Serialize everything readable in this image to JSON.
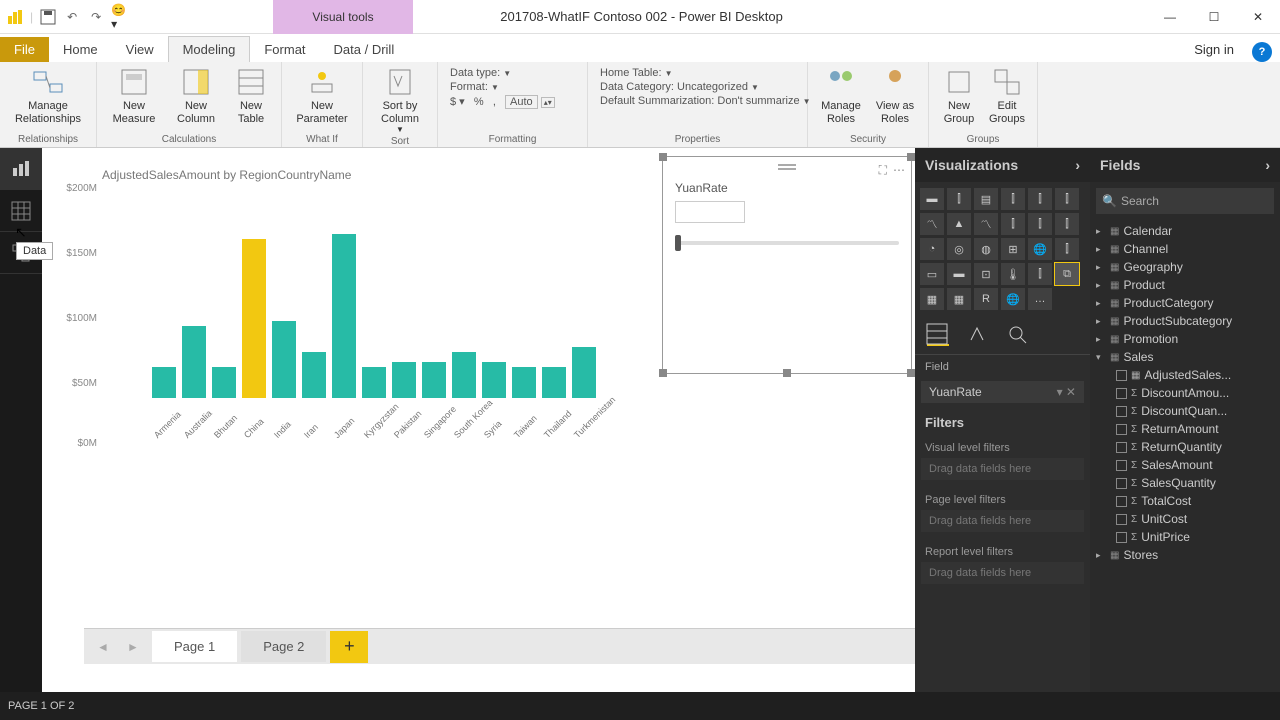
{
  "appTitle": "201708-WhatIF Contoso 002 - Power BI Desktop",
  "visualTools": "Visual tools",
  "quickAccess": {
    "undo": "↶",
    "redo": "↷"
  },
  "menus": {
    "file": "File",
    "home": "Home",
    "view": "View",
    "modeling": "Modeling",
    "format": "Format",
    "datadrill": "Data / Drill",
    "signin": "Sign in"
  },
  "ribbon": {
    "relationships": {
      "group": "Relationships",
      "manage": "Manage Relationships"
    },
    "calculations": {
      "group": "Calculations",
      "newMeasure": "New Measure",
      "newColumn": "New Column",
      "newTable": "New Table"
    },
    "whatif": {
      "group": "What If",
      "newParam": "New Parameter"
    },
    "sort": {
      "group": "Sort",
      "sortby": "Sort by Column"
    },
    "formatting": {
      "group": "Formatting",
      "datatype": "Data type:",
      "format": "Format:",
      "auto": "Auto"
    },
    "properties": {
      "group": "Properties",
      "hometable": "Home Table:",
      "datacat": "Data Category: Uncategorized",
      "summ": "Default Summarization: Don't summarize"
    },
    "security": {
      "group": "Security",
      "manageRoles": "Manage Roles",
      "viewAs": "View as Roles"
    },
    "groups": {
      "group": "Groups",
      "newGroup": "New Group",
      "editGroups": "Edit Groups"
    }
  },
  "leftbar": {
    "tooltip": "Data"
  },
  "chart": {
    "title": "AdjustedSalesAmount by RegionCountryName",
    "ylabels": [
      "$200M",
      "$150M",
      "$100M",
      "$50M",
      "$0M"
    ]
  },
  "chart_data": {
    "type": "bar",
    "title": "AdjustedSalesAmount by RegionCountryName",
    "ylabel": "AdjustedSalesAmount",
    "xlabel": "RegionCountryName",
    "ylim": [
      0,
      200
    ],
    "unit": "$M",
    "categories": [
      "Armenia",
      "Australia",
      "Bhutan",
      "China",
      "India",
      "Iran",
      "Japan",
      "Kyrgyzstan",
      "Pakistan",
      "Singapore",
      "South Korea",
      "Syria",
      "Taiwan",
      "Thailand",
      "Turkmenistan"
    ],
    "values": [
      30,
      70,
      30,
      155,
      75,
      45,
      160,
      30,
      35,
      35,
      45,
      35,
      30,
      30,
      50
    ],
    "highlight_index": 3
  },
  "slicer": {
    "title": "YuanRate"
  },
  "vizPane": {
    "title": "Visualizations",
    "fieldLabel": "Field",
    "fieldValue": "YuanRate"
  },
  "filtersPane": {
    "title": "Filters",
    "visualLevel": "Visual level filters",
    "drag": "Drag data fields here",
    "pageLevel": "Page level filters",
    "reportLevel": "Report level filters"
  },
  "fieldsPane": {
    "title": "Fields",
    "searchPlaceholder": "Search",
    "tables": [
      "Calendar",
      "Channel",
      "Geography",
      "Product",
      "ProductCategory",
      "ProductSubcategory",
      "Promotion",
      "Sales",
      "Stores"
    ],
    "salesFields": [
      {
        "name": "AdjustedSales...",
        "checked": false,
        "type": "measure"
      },
      {
        "name": "DiscountAmou...",
        "checked": false,
        "type": "sum"
      },
      {
        "name": "DiscountQuan...",
        "checked": false,
        "type": "sum"
      },
      {
        "name": "ReturnAmount",
        "checked": false,
        "type": "sum"
      },
      {
        "name": "ReturnQuantity",
        "checked": false,
        "type": "sum"
      },
      {
        "name": "SalesAmount",
        "checked": false,
        "type": "sum"
      },
      {
        "name": "SalesQuantity",
        "checked": false,
        "type": "sum"
      },
      {
        "name": "TotalCost",
        "checked": false,
        "type": "sum"
      },
      {
        "name": "UnitCost",
        "checked": false,
        "type": "sum"
      },
      {
        "name": "UnitPrice",
        "checked": false,
        "type": "sum"
      }
    ]
  },
  "pageTabs": {
    "page1": "Page 1",
    "page2": "Page 2"
  },
  "statusbar": "PAGE 1 OF 2"
}
